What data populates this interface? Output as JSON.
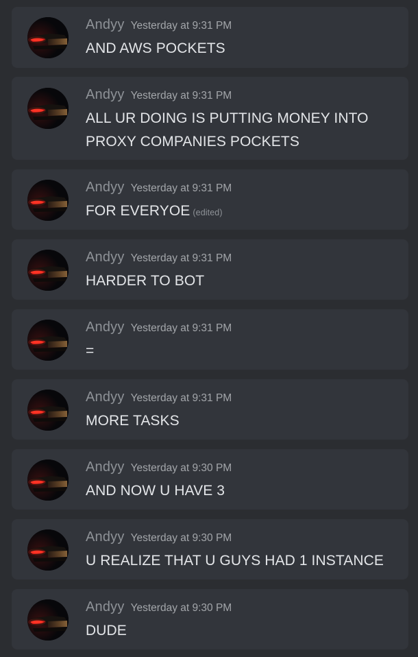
{
  "messages": [
    {
      "author": "Andyy",
      "timestamp": "Yesterday at 9:31 PM",
      "text": "AND AWS POCKETS",
      "edited": ""
    },
    {
      "author": "Andyy",
      "timestamp": "Yesterday at 9:31 PM",
      "text": "ALL UR DOING IS PUTTING MONEY INTO PROXY COMPANIES POCKETS",
      "edited": ""
    },
    {
      "author": "Andyy",
      "timestamp": "Yesterday at 9:31 PM",
      "text": "FOR EVERYOE",
      "edited": "(edited)"
    },
    {
      "author": "Andyy",
      "timestamp": "Yesterday at 9:31 PM",
      "text": "HARDER TO BOT",
      "edited": ""
    },
    {
      "author": "Andyy",
      "timestamp": "Yesterday at 9:31 PM",
      "text": "=",
      "edited": ""
    },
    {
      "author": "Andyy",
      "timestamp": "Yesterday at 9:31 PM",
      "text": "MORE TASKS",
      "edited": ""
    },
    {
      "author": "Andyy",
      "timestamp": "Yesterday at 9:30 PM",
      "text": "AND NOW U HAVE 3",
      "edited": ""
    },
    {
      "author": "Andyy",
      "timestamp": "Yesterday at 9:30 PM",
      "text": "U REALIZE THAT U GUYS HAD 1 INSTANCE",
      "edited": ""
    },
    {
      "author": "Andyy",
      "timestamp": "Yesterday at 9:30 PM",
      "text": "DUDE",
      "edited": ""
    }
  ],
  "colors": {
    "background": "#2b2d31",
    "card": "#32353b",
    "author": "#8e9297",
    "message_text": "#e3e5e8"
  },
  "icons": {
    "avatar": "dark-car-taillight-avatar"
  }
}
